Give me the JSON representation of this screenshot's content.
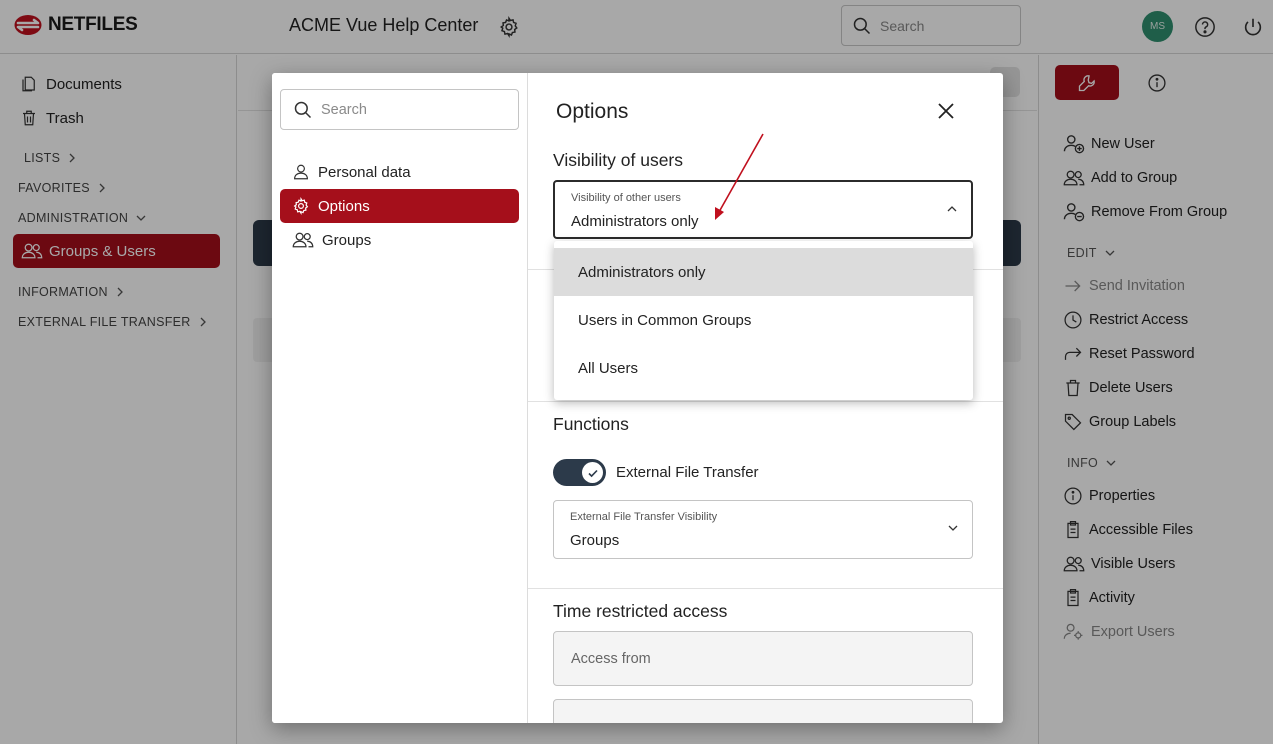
{
  "brand": {
    "logo_text": "NETFILES",
    "accent": "#a50f1b"
  },
  "header": {
    "app_title": "ACME Vue Help Center",
    "search_placeholder": "Search",
    "avatar_initials": "MS"
  },
  "left_nav": {
    "documents": "Documents",
    "trash": "Trash",
    "lists": "LISTS",
    "favorites": "FAVORITES",
    "administration": "ADMINISTRATION",
    "groups_users": "Groups & Users",
    "information": "INFORMATION",
    "external_file_transfer": "EXTERNAL FILE TRANSFER"
  },
  "right_panel": {
    "actions": {
      "new_user": "New User",
      "add_to_group": "Add to Group",
      "remove_from_group": "Remove From Group"
    },
    "edit_section": "EDIT",
    "edit": {
      "send_invitation": "Send Invitation",
      "restrict_access": "Restrict Access",
      "reset_password": "Reset Password",
      "delete_users": "Delete Users",
      "group_labels": "Group Labels"
    },
    "info_section": "INFO",
    "info": {
      "properties": "Properties",
      "accessible_files": "Accessible Files",
      "visible_users": "Visible Users",
      "activity": "Activity",
      "export_users": "Export Users"
    }
  },
  "modal": {
    "search_placeholder": "Search",
    "side_items": [
      "Personal data",
      "Options",
      "Groups"
    ],
    "title": "Options",
    "visibility_section": "Visibility of users",
    "visibility_field_label": "Visibility of other users",
    "visibility_value": "Administrators only",
    "visibility_options": [
      "Administrators only",
      "Users in Common Groups",
      "All Users"
    ],
    "functions_section": "Functions",
    "toggle_label": "External File Transfer",
    "toggle_on": true,
    "eft_visibility_label": "External File Transfer Visibility",
    "eft_visibility_value": "Groups",
    "time_section": "Time restricted access",
    "access_from_placeholder": "Access from"
  }
}
